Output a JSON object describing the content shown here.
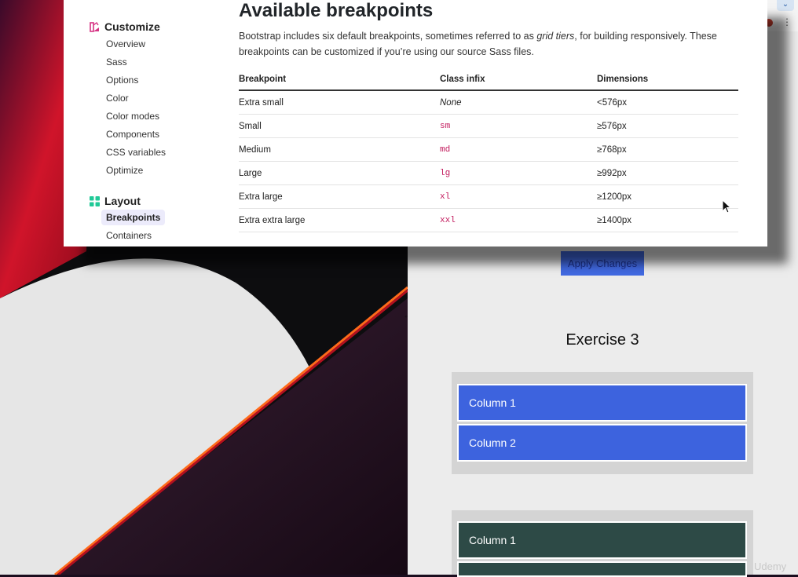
{
  "docs": {
    "sidebar": {
      "customize": {
        "heading": "Customize",
        "items": [
          "Overview",
          "Sass",
          "Options",
          "Color",
          "Color modes",
          "Components",
          "CSS variables",
          "Optimize"
        ]
      },
      "layout": {
        "heading": "Layout",
        "items": [
          "Breakpoints",
          "Containers"
        ],
        "active": "Breakpoints"
      }
    },
    "title": "Available breakpoints",
    "description_before": "Bootstrap includes six default breakpoints, sometimes referred to as ",
    "description_em": "grid tiers",
    "description_after": ", for building responsively. These breakpoints can be customized if you’re using our source Sass files.",
    "table": {
      "headers": [
        "Breakpoint",
        "Class infix",
        "Dimensions"
      ],
      "rows": [
        {
          "breakpoint": "Extra small",
          "infix": "None",
          "dimensions": "<576px"
        },
        {
          "breakpoint": "Small",
          "infix": "sm",
          "dimensions": "≥576px"
        },
        {
          "breakpoint": "Medium",
          "infix": "md",
          "dimensions": "≥768px"
        },
        {
          "breakpoint": "Large",
          "infix": "lg",
          "dimensions": "≥992px"
        },
        {
          "breakpoint": "Extra large",
          "infix": "xl",
          "dimensions": "≥1200px"
        },
        {
          "breakpoint": "Extra extra large",
          "infix": "xxl",
          "dimensions": "≥1400px"
        }
      ]
    }
  },
  "exercise": {
    "apply_button": "Apply Changes",
    "title": "Exercise 3",
    "block1": [
      "Column 1",
      "Column 2"
    ],
    "block2": [
      "Column 1"
    ],
    "watermark": "Udemy"
  },
  "icons": {
    "customize_icon": "palette-icon",
    "layout_icon": "grid-icon",
    "browser_menu": "kebab-icon",
    "cursor": "arrow-cursor-icon",
    "resize": "resize-cursor-icon"
  },
  "colors": {
    "column_blue": "#3d63de",
    "column_green": "#2d4a46",
    "apply_button": "#4169e1",
    "code_pink": "#c2185b"
  }
}
